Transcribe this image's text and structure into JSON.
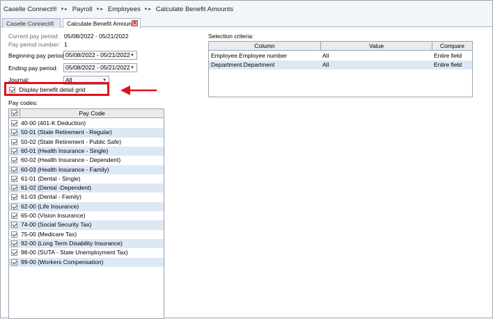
{
  "breadcrumb": [
    "Caselle Connect®",
    "Payroll",
    "Employees",
    "Calculate Benefit Amounts"
  ],
  "tabs": [
    {
      "label": "Caselle Connect®",
      "active": false
    },
    {
      "label": "Calculate Benefit Amounts",
      "active": true
    }
  ],
  "form": {
    "current_period_label": "Current pay period:",
    "current_period_value": "05/08/2022 - 05/21/2022",
    "period_number_label": "Pay period number:",
    "period_number_value": "1",
    "beginning_label": "Beginning pay period:",
    "beginning_value": "05/08/2022 - 05/21/2022",
    "ending_label": "Ending pay period:",
    "ending_value": "05/08/2022 - 05/21/2022",
    "journal_label": "Journal:",
    "journal_value": "All",
    "display_grid_label": "Display benefit detail grid",
    "pay_codes_label": "Pay codes:"
  },
  "pay_codes": {
    "header": "Pay Code",
    "rows": [
      "40-00 (401-K Deduction)",
      "50-01 (State Retirement - Regular)",
      "50-02 (State Retirement - Public Safe)",
      "60-01 (Health Insurance - Single)",
      "60-02 (Health Insurance - Dependent)",
      "60-03 (Health Insurance - Family)",
      "61-01 (Dental - Single)",
      "61-02 (Dental -Dependent)",
      "61-03 (Dental - Family)",
      "62-00 (Life Insurance)",
      "65-00 (Vision Insurance)",
      "74-00 (Social Security Tax)",
      "75-00 (Medicare Tax)",
      "92-00 (Long Term Disability Insurance)",
      "98-00 (SUTA - State Unemployment Tax)",
      "99-00 (Workers Compensation)"
    ]
  },
  "selection": {
    "label": "Selection criteria:",
    "columns": [
      "Column",
      "Value",
      "Compare"
    ],
    "rows": [
      [
        "Employee.Employee number",
        "All",
        "Entire field"
      ],
      [
        "Department.Department",
        "All",
        "Entire field"
      ]
    ]
  },
  "colors": {
    "highlight": "#e3101b",
    "row_alt": "#dde8f5"
  }
}
